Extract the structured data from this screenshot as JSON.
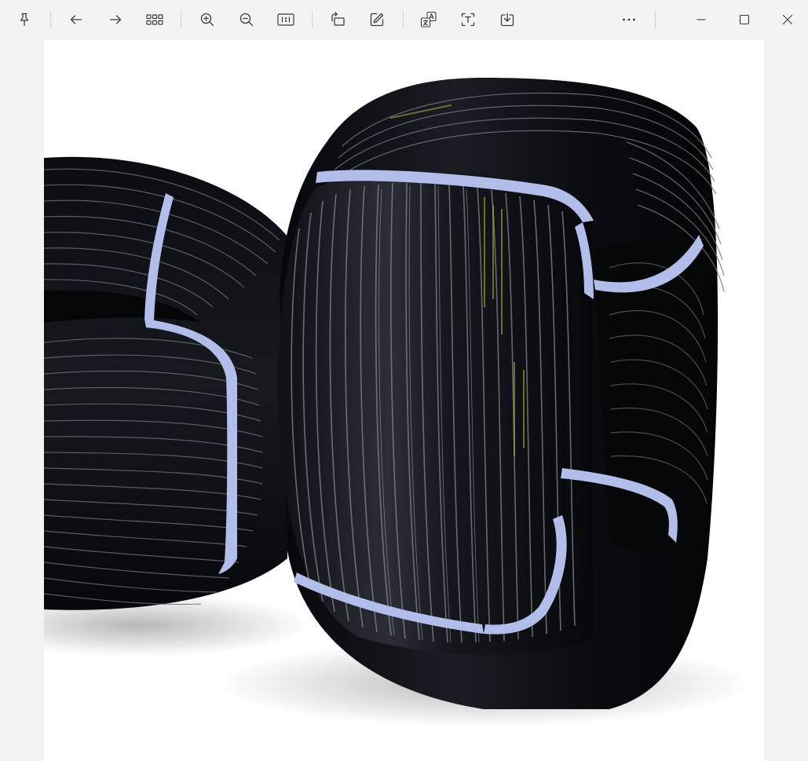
{
  "toolbar": {
    "pin": {
      "icon": "pin-icon"
    },
    "previous": {
      "icon": "arrow-left-icon"
    },
    "next": {
      "icon": "arrow-right-icon"
    },
    "gallery": {
      "icon": "grid-icon"
    },
    "zoom_in": {
      "icon": "zoom-in-icon"
    },
    "zoom_out": {
      "icon": "zoom-out-icon"
    },
    "actual_size": {
      "icon": "actual-size-icon"
    },
    "rotate": {
      "icon": "rotate-icon"
    },
    "edit": {
      "icon": "edit-icon"
    },
    "translate": {
      "icon": "translate-icon"
    },
    "ocr": {
      "icon": "text-recognition-icon"
    },
    "save": {
      "icon": "download-icon"
    },
    "more": {
      "icon": "more-icon"
    }
  },
  "window_controls": {
    "minimize": {
      "icon": "minimize-icon"
    },
    "maximize": {
      "icon": "maximize-icon"
    },
    "close": {
      "icon": "close-icon"
    }
  },
  "colors": {
    "chrome_bg": "#f3f3f3",
    "icon_stroke": "#3b3b3b",
    "canvas_bg": "#ffffff",
    "pipe_black": "#0c0e12",
    "strap_blue": "#b3bdea"
  },
  "image": {
    "subject": "black-pipe-coils"
  }
}
